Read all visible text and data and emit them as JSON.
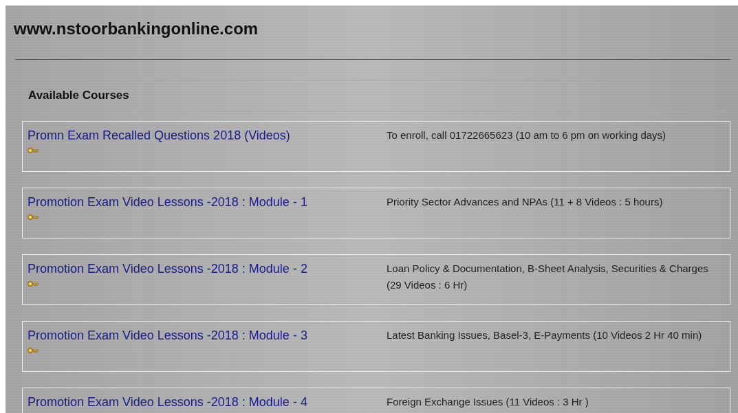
{
  "site_title": "www.nstoorbankingonline.com",
  "section_heading": "Available Courses",
  "courses": [
    {
      "title": "Promn Exam Recalled Questions 2018 (Videos)",
      "description": "To enroll, call 01722665623 (10 am to 6 pm on working days)"
    },
    {
      "title": "Promotion Exam Video Lessons -2018 : Module - 1",
      "description": "Priority Sector Advances and NPAs (11 + 8 Videos : 5 hours)"
    },
    {
      "title": "Promotion Exam Video Lessons -2018 : Module - 2",
      "description": "Loan Policy & Documentation, B-Sheet Analysis, Securities & Charges (29 Videos : 6 Hr)"
    },
    {
      "title": "Promotion Exam Video Lessons -2018 : Module - 3",
      "description": "Latest Banking Issues, Basel-3, E-Payments (10 Videos 2 Hr 40 min)"
    },
    {
      "title": "Promotion Exam Video Lessons -2018 : Module - 4",
      "description": "Foreign Exchange Issues (11 Videos : 3 Hr )"
    }
  ]
}
